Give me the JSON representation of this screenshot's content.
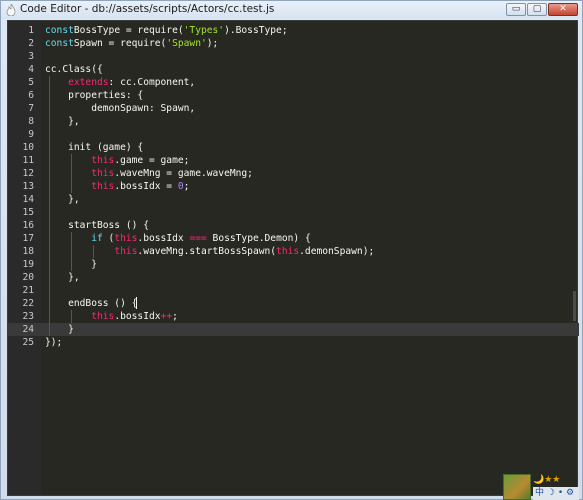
{
  "window": {
    "title": "Code Editor - db://assets/scripts/Actors/cc.test.js",
    "controls": {
      "minimize": "▭",
      "maximize": "▢",
      "close": "✕"
    }
  },
  "editor": {
    "active_line": 24,
    "lines": [
      {
        "n": "1",
        "parts": [
          [
            "kw",
            "const"
          ],
          [
            "",
            "BossType = require("
          ],
          [
            "str",
            "'Types'"
          ],
          [
            "",
            ").BossType;"
          ]
        ]
      },
      {
        "n": "2",
        "parts": [
          [
            "kw",
            "const"
          ],
          [
            "",
            "Spawn = require("
          ],
          [
            "str",
            "'Spawn'"
          ],
          [
            "",
            ");"
          ]
        ]
      },
      {
        "n": "3",
        "parts": []
      },
      {
        "n": "4",
        "parts": [
          [
            "",
            "cc.Class({"
          ]
        ]
      },
      {
        "n": "5",
        "parts": [
          [
            "",
            "    "
          ],
          [
            "prop",
            "extends"
          ],
          [
            "",
            ": cc.Component,"
          ]
        ]
      },
      {
        "n": "6",
        "parts": [
          [
            "",
            "    properties: {"
          ]
        ]
      },
      {
        "n": "7",
        "parts": [
          [
            "",
            "        demonSpawn: Spawn,"
          ]
        ]
      },
      {
        "n": "8",
        "parts": [
          [
            "",
            "    },"
          ]
        ]
      },
      {
        "n": "9",
        "parts": []
      },
      {
        "n": "10",
        "parts": [
          [
            "",
            "    init (game) {"
          ]
        ]
      },
      {
        "n": "11",
        "parts": [
          [
            "",
            "        "
          ],
          [
            "this",
            "this"
          ],
          [
            "",
            ".game = game;"
          ]
        ]
      },
      {
        "n": "12",
        "parts": [
          [
            "",
            "        "
          ],
          [
            "this",
            "this"
          ],
          [
            "",
            ".waveMng = game.waveMng;"
          ]
        ]
      },
      {
        "n": "13",
        "parts": [
          [
            "",
            "        "
          ],
          [
            "this",
            "this"
          ],
          [
            "",
            ".bossIdx = "
          ],
          [
            "num",
            "0"
          ],
          [
            "",
            ";"
          ]
        ]
      },
      {
        "n": "14",
        "parts": [
          [
            "",
            "    },"
          ]
        ]
      },
      {
        "n": "15",
        "parts": []
      },
      {
        "n": "16",
        "parts": [
          [
            "",
            "    startBoss () {"
          ]
        ]
      },
      {
        "n": "17",
        "parts": [
          [
            "",
            "        "
          ],
          [
            "kw",
            "if"
          ],
          [
            "",
            " ("
          ],
          [
            "this",
            "this"
          ],
          [
            "",
            ".bossIdx "
          ],
          [
            "op",
            "==="
          ],
          [
            "",
            " BossType.Demon) {"
          ]
        ]
      },
      {
        "n": "18",
        "parts": [
          [
            "",
            "            "
          ],
          [
            "this",
            "this"
          ],
          [
            "",
            ".waveMng.startBossSpawn("
          ],
          [
            "this",
            "this"
          ],
          [
            "",
            ".demonSpawn);"
          ]
        ]
      },
      {
        "n": "19",
        "parts": [
          [
            "",
            "        }"
          ]
        ]
      },
      {
        "n": "20",
        "parts": [
          [
            "",
            "    },"
          ]
        ]
      },
      {
        "n": "21",
        "parts": []
      },
      {
        "n": "22",
        "parts": [
          [
            "",
            "    endBoss () {"
          ]
        ]
      },
      {
        "n": "23",
        "parts": [
          [
            "",
            "        "
          ],
          [
            "this",
            "this"
          ],
          [
            "",
            ".bossIdx"
          ],
          [
            "op",
            "++"
          ],
          [
            "",
            ";"
          ]
        ]
      },
      {
        "n": "24",
        "parts": [
          [
            "",
            "    }"
          ]
        ]
      },
      {
        "n": "25",
        "parts": [
          [
            "",
            "});"
          ]
        ]
      }
    ]
  },
  "tray": {
    "top_icons": "🌙★★",
    "ime_label": "中",
    "ime_icons": "☽ • ⚙"
  }
}
